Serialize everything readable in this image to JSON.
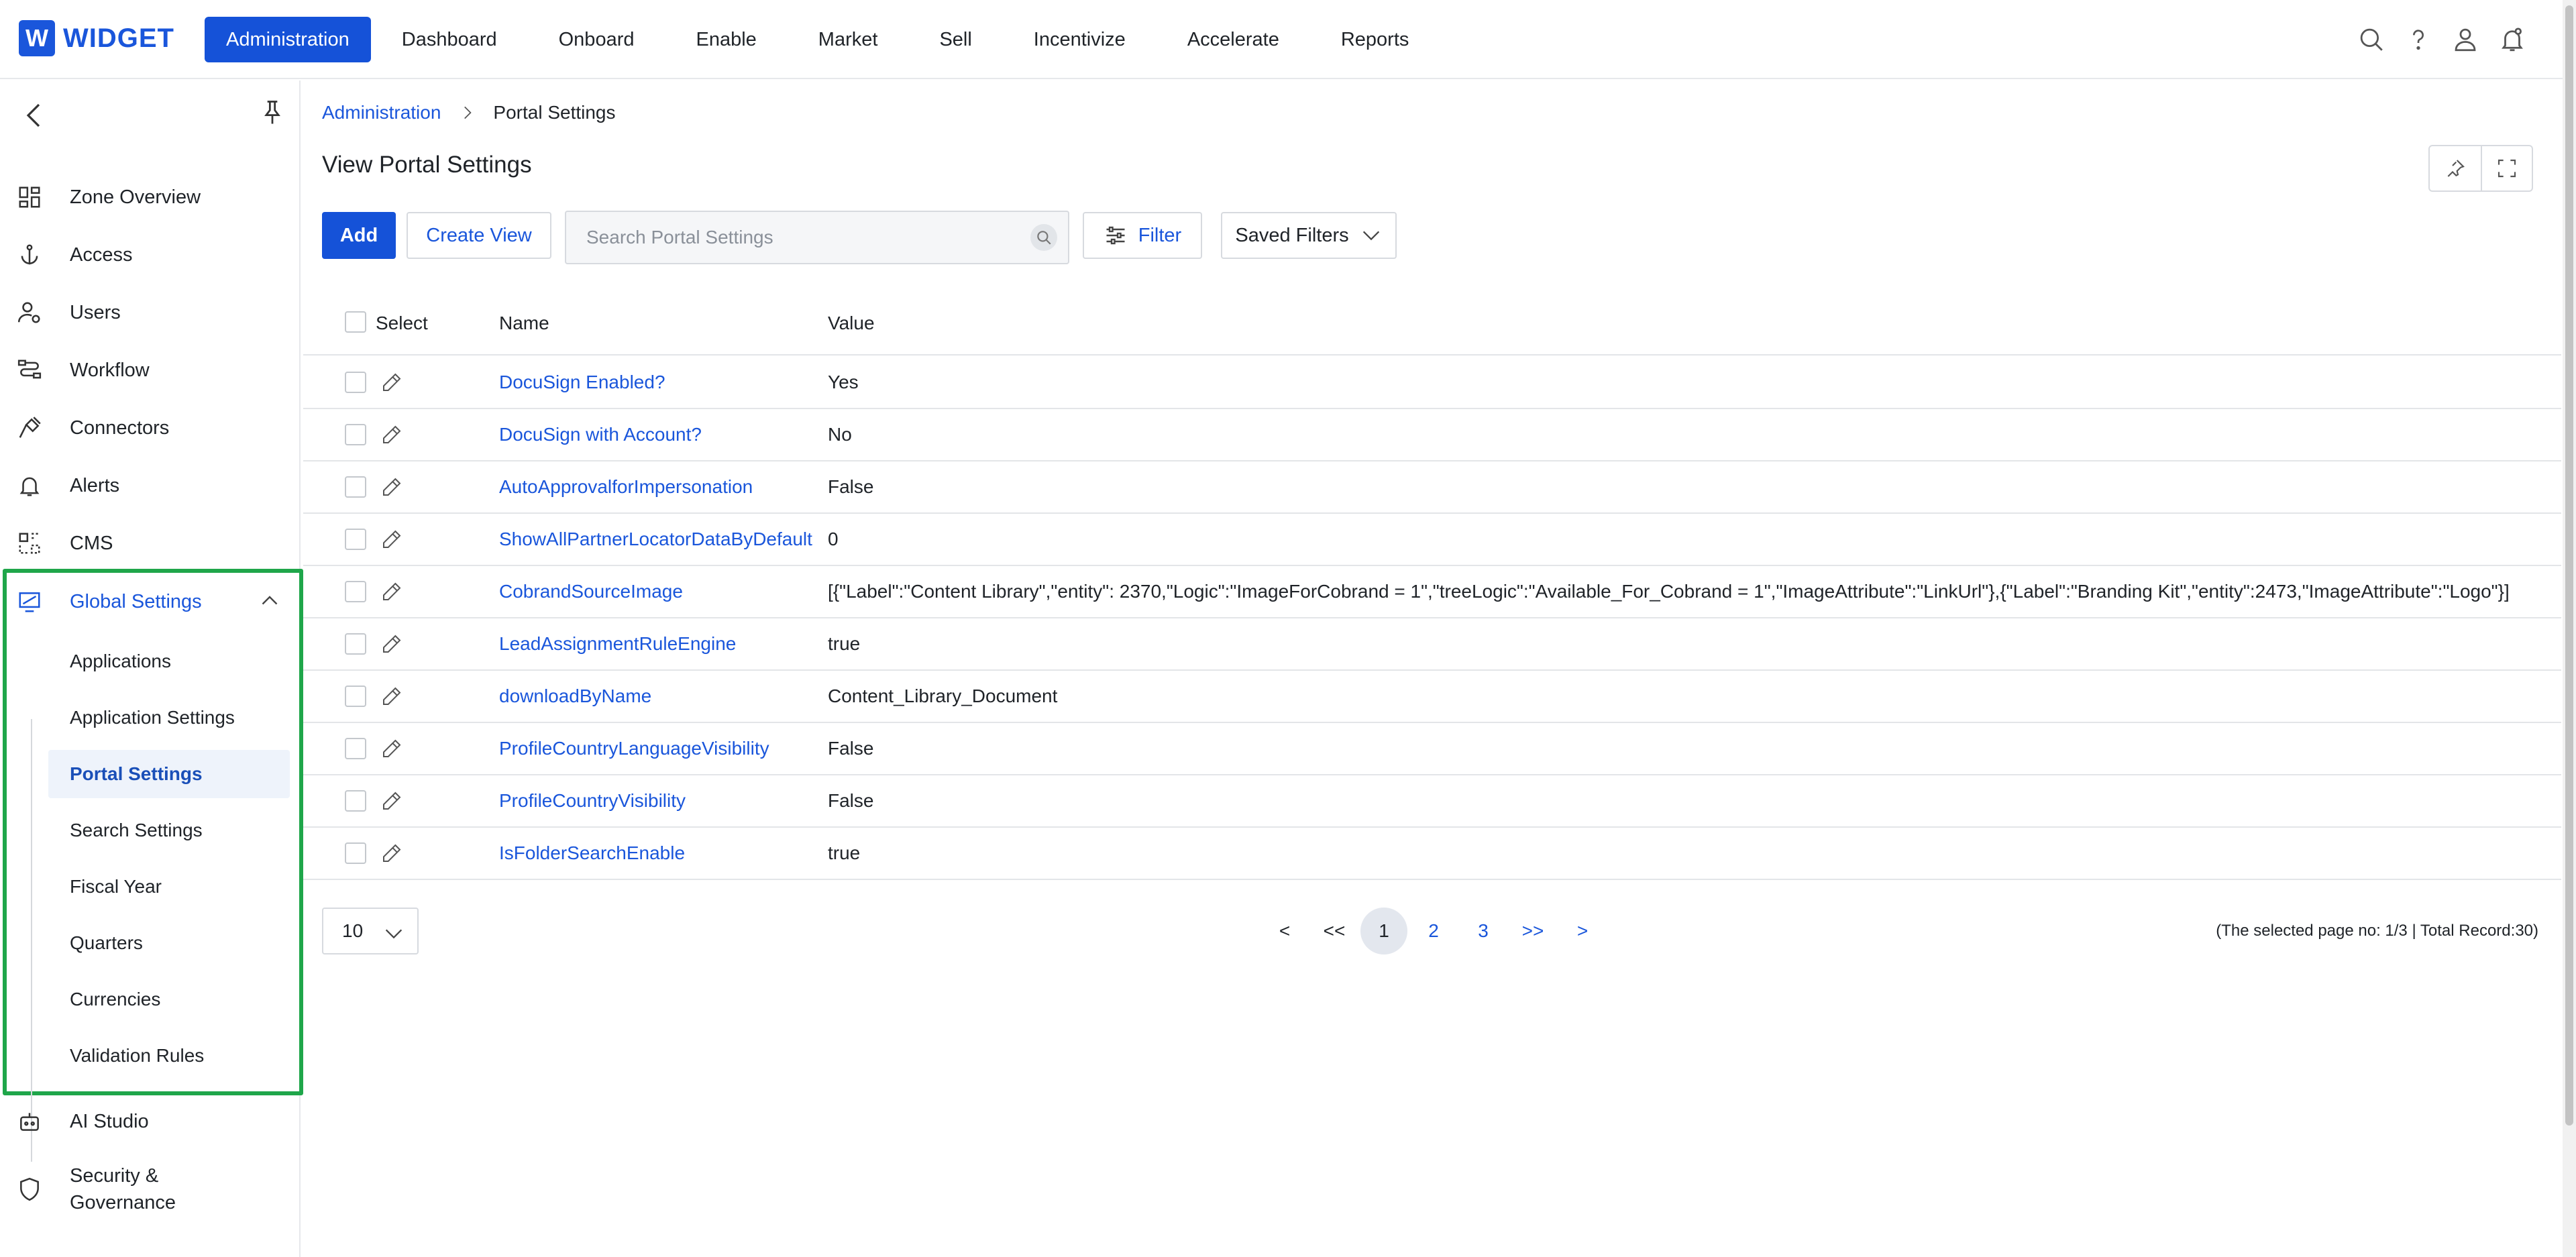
{
  "app": {
    "logo_letter": "W",
    "logo_text": "WIDGET"
  },
  "nav": [
    {
      "label": "Administration",
      "active": true
    },
    {
      "label": "Dashboard"
    },
    {
      "label": "Onboard"
    },
    {
      "label": "Enable"
    },
    {
      "label": "Market"
    },
    {
      "label": "Sell"
    },
    {
      "label": "Incentivize"
    },
    {
      "label": "Accelerate"
    },
    {
      "label": "Reports"
    }
  ],
  "top_icons": [
    "search-icon",
    "help-icon",
    "user-icon",
    "notification-bell-icon"
  ],
  "sidebar": {
    "items": [
      {
        "label": "Zone Overview",
        "icon": "grid-icon"
      },
      {
        "label": "Access",
        "icon": "anchor-icon"
      },
      {
        "label": "Users",
        "icon": "user-gear-icon"
      },
      {
        "label": "Workflow",
        "icon": "workflow-icon"
      },
      {
        "label": "Connectors",
        "icon": "plug-icon"
      },
      {
        "label": "Alerts",
        "icon": "bell-icon"
      },
      {
        "label": "CMS",
        "icon": "cms-icon"
      }
    ],
    "global_settings": {
      "label": "Global Settings",
      "children": [
        {
          "label": "Applications"
        },
        {
          "label": "Application Settings"
        },
        {
          "label": "Portal Settings",
          "active": true
        },
        {
          "label": "Search Settings"
        },
        {
          "label": "Fiscal Year"
        },
        {
          "label": "Quarters"
        },
        {
          "label": "Currencies"
        },
        {
          "label": "Validation Rules"
        }
      ]
    },
    "bottom_items": [
      {
        "label": "AI Studio",
        "icon": "robot-icon"
      },
      {
        "label_line1": "Security &",
        "label_line2": "Governance",
        "icon": "shield-icon"
      }
    ]
  },
  "breadcrumb": {
    "parent": "Administration",
    "current": "Portal Settings"
  },
  "page_title": "View Portal Settings",
  "toolbar": {
    "add_label": "Add",
    "create_view_label": "Create View",
    "search_placeholder": "Search Portal Settings",
    "filter_label": "Filter",
    "saved_filters_label": "Saved Filters"
  },
  "table": {
    "columns": {
      "select": "Select",
      "name": "Name",
      "value": "Value"
    },
    "rows": [
      {
        "name": "DocuSign Enabled?",
        "value": "Yes"
      },
      {
        "name": "DocuSign with Account?",
        "value": "No"
      },
      {
        "name": "AutoApprovalforImpersonation",
        "value": "False"
      },
      {
        "name": "ShowAllPartnerLocatorDataByDefault",
        "value": "0"
      },
      {
        "name": "CobrandSourceImage",
        "value": "[{\"Label\":\"Content Library\",\"entity\": 2370,\"Logic\":\"ImageForCobrand = 1\",\"treeLogic\":\"Available_For_Cobrand = 1\",\"ImageAttribute\":\"LinkUrl\"},{\"Label\":\"Branding Kit\",\"entity\":2473,\"ImageAttribute\":\"Logo\"}]"
      },
      {
        "name": "LeadAssignmentRuleEngine",
        "value": "true"
      },
      {
        "name": "downloadByName",
        "value": "Content_Library_Document"
      },
      {
        "name": "ProfileCountryLanguageVisibility",
        "value": "False"
      },
      {
        "name": "ProfileCountryVisibility",
        "value": "False"
      },
      {
        "name": "IsFolderSearchEnable",
        "value": "true"
      }
    ]
  },
  "pagination": {
    "page_size": "10",
    "prev": "<",
    "first": "<<",
    "pages": [
      "1",
      "2",
      "3"
    ],
    "current_page": "1",
    "last": ">>",
    "next": ">",
    "info": "(The selected page no: 1/3 | Total Record:30)"
  },
  "colors": {
    "accent": "#1552d8",
    "link": "#1a56db",
    "highlight_border": "#1fa64a"
  }
}
